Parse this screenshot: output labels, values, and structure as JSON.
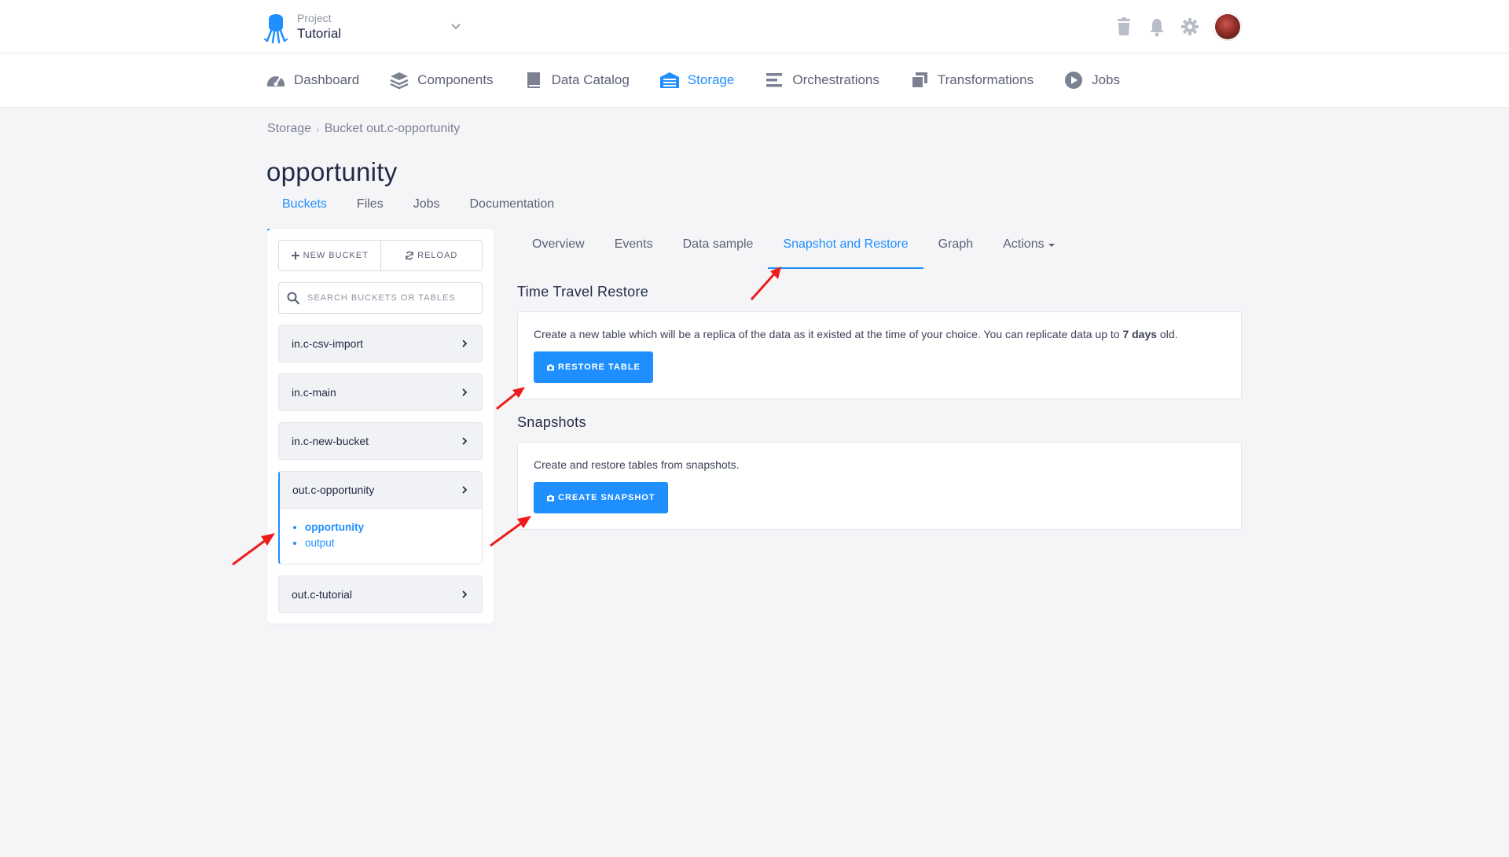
{
  "header": {
    "project_label": "Project",
    "project_name": "Tutorial",
    "icons": [
      "trash-icon",
      "bell-icon",
      "gear-icon",
      "avatar"
    ]
  },
  "nav": {
    "items": [
      {
        "label": "Dashboard",
        "icon": "dashboard-icon"
      },
      {
        "label": "Components",
        "icon": "layers-icon"
      },
      {
        "label": "Data Catalog",
        "icon": "book-icon"
      },
      {
        "label": "Storage",
        "icon": "warehouse-icon",
        "active": true
      },
      {
        "label": "Orchestrations",
        "icon": "bars-icon"
      },
      {
        "label": "Transformations",
        "icon": "windows-icon"
      },
      {
        "label": "Jobs",
        "icon": "play-icon"
      }
    ]
  },
  "breadcrumb": {
    "root": "Storage",
    "current": "Bucket out.c-opportunity"
  },
  "page_title": "opportunity",
  "subtabs": [
    {
      "label": "Buckets",
      "active": true
    },
    {
      "label": "Files"
    },
    {
      "label": "Jobs"
    },
    {
      "label": "Documentation"
    }
  ],
  "sidebar": {
    "new_bucket": "NEW BUCKET",
    "reload": "RELOAD",
    "search_placeholder": "SEARCH BUCKETS OR TABLES",
    "buckets": [
      {
        "name": "in.c-csv-import"
      },
      {
        "name": "in.c-main"
      },
      {
        "name": "in.c-new-bucket"
      },
      {
        "name": "out.c-opportunity",
        "open": true,
        "tables": [
          "opportunity",
          "output"
        ],
        "current_table": "opportunity"
      },
      {
        "name": "out.c-tutorial"
      }
    ]
  },
  "content_tabs": [
    {
      "label": "Overview"
    },
    {
      "label": "Events"
    },
    {
      "label": "Data sample"
    },
    {
      "label": "Snapshot and Restore",
      "active": true
    },
    {
      "label": "Graph"
    },
    {
      "label": "Actions"
    }
  ],
  "time_travel": {
    "title": "Time Travel Restore",
    "text_before": "Create a new table which will be a replica of the data as it existed at the time of your choice. You can replicate data up to ",
    "text_bold": "7 days",
    "text_after": " old.",
    "button": "RESTORE TABLE"
  },
  "snapshots": {
    "title": "Snapshots",
    "text": "Create and restore tables from snapshots.",
    "button": "CREATE SNAPSHOT"
  },
  "colors": {
    "accent": "#1f8fff",
    "background": "#f5f5f8",
    "annotation": "#ee1c1c"
  }
}
